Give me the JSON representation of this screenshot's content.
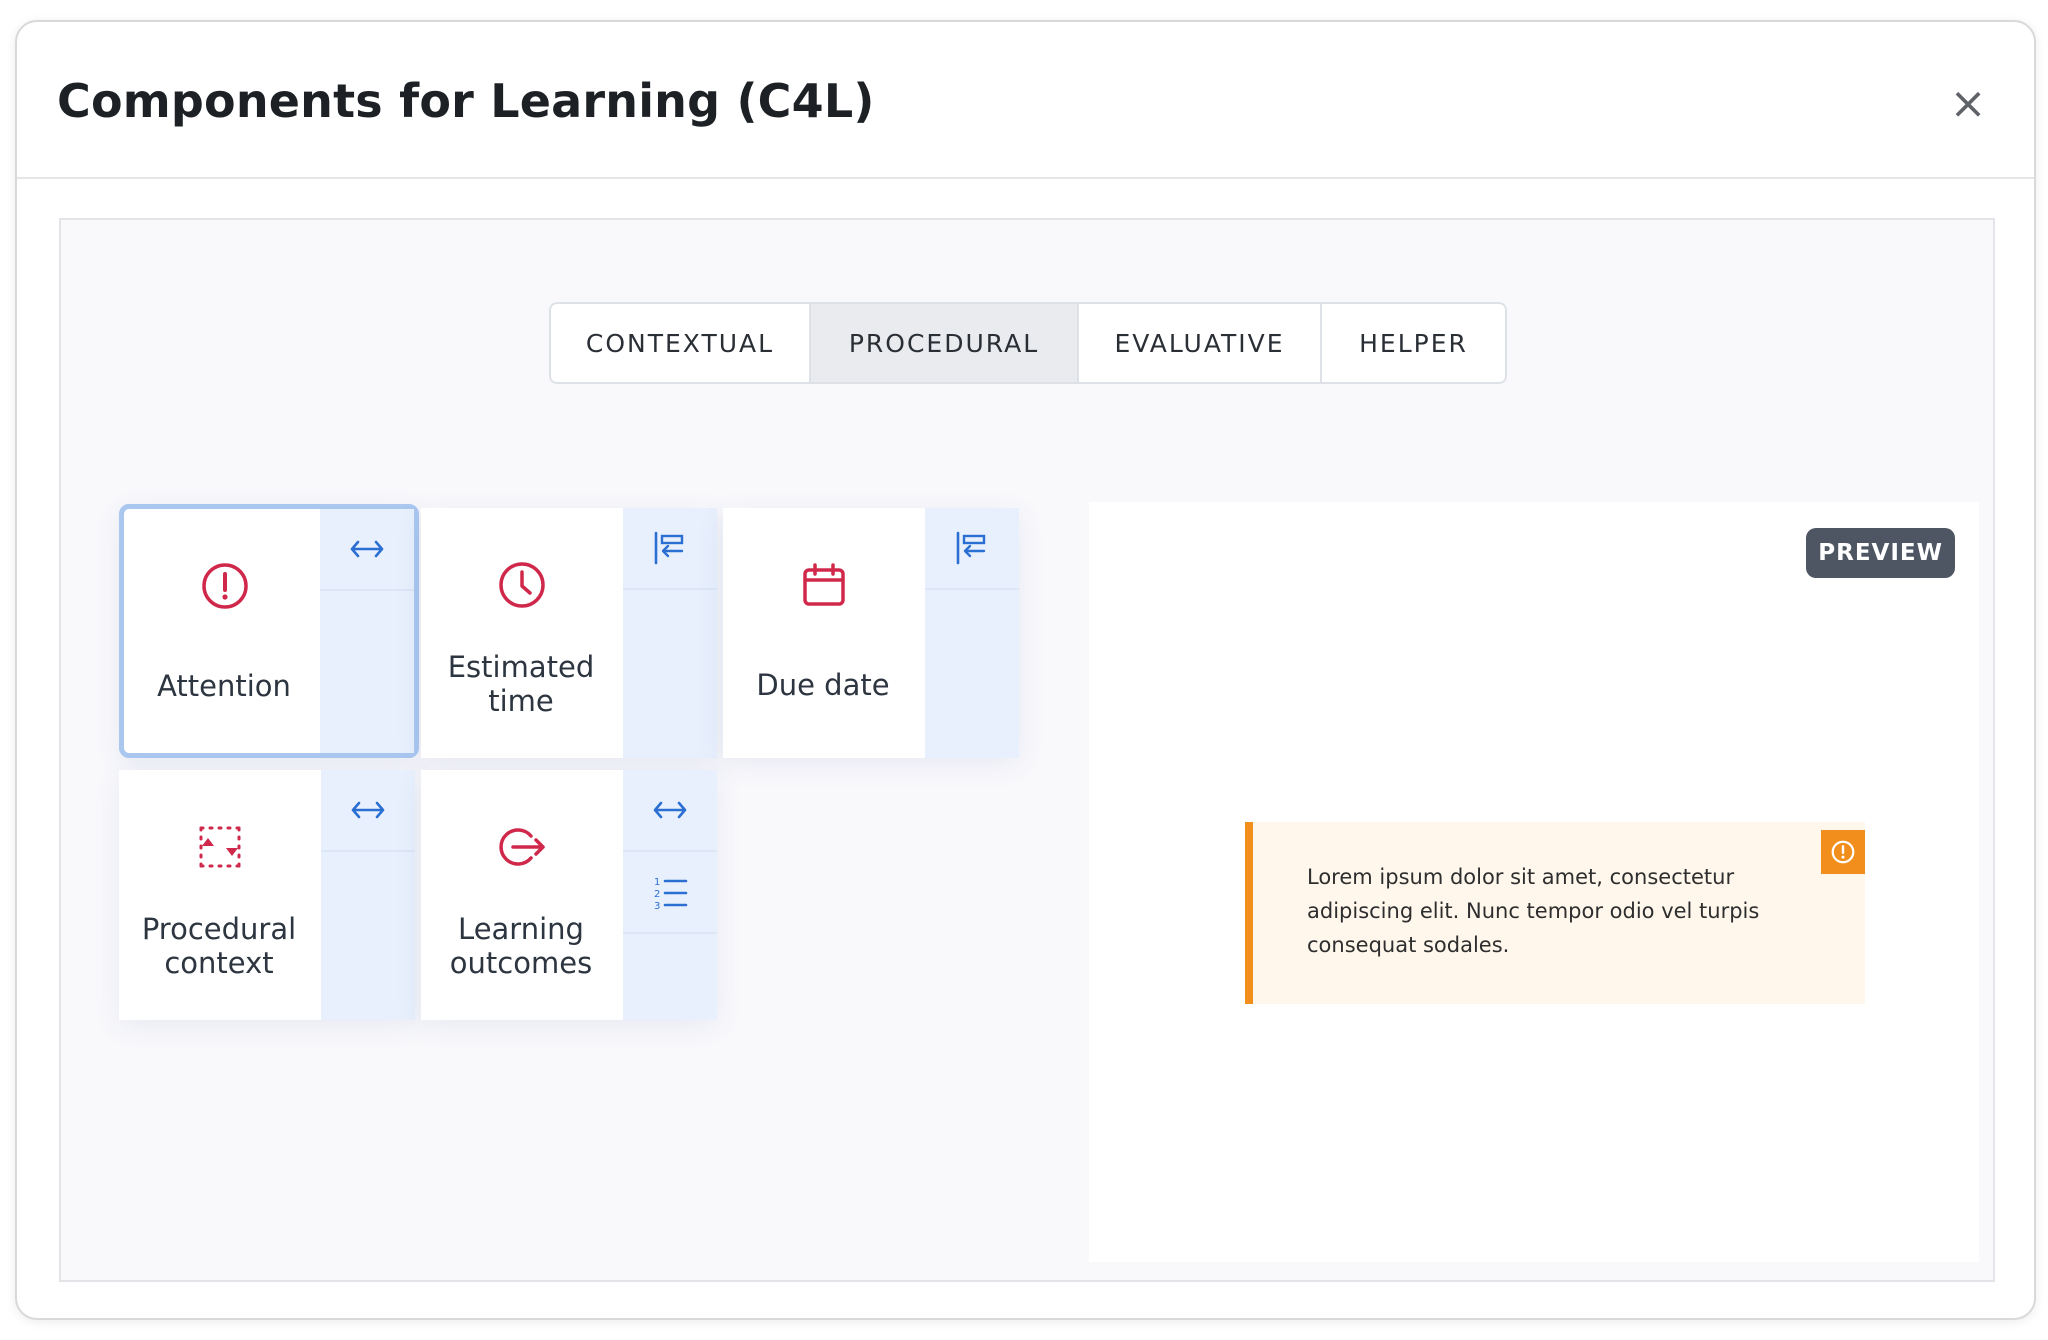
{
  "modal": {
    "title": "Components for Learning (C4L)",
    "close_symbol": "×"
  },
  "tabs": [
    {
      "label": "CONTEXTUAL",
      "active": false
    },
    {
      "label": "PROCEDURAL",
      "active": true
    },
    {
      "label": "EVALUATIVE",
      "active": false
    },
    {
      "label": "HELPER",
      "active": false
    }
  ],
  "components": [
    {
      "label": "Attention",
      "icon": "alert-circle-icon",
      "selected": true,
      "side_icons": [
        "arrows-horizontal-icon"
      ]
    },
    {
      "label": "Estimated time",
      "icon": "clock-icon",
      "selected": false,
      "side_icons": [
        "align-left-icon"
      ]
    },
    {
      "label": "Due date",
      "icon": "calendar-icon",
      "selected": false,
      "side_icons": [
        "align-left-icon"
      ]
    },
    {
      "label": "Procedural context",
      "icon": "procedural-context-icon",
      "selected": false,
      "side_icons": [
        "arrows-horizontal-icon"
      ]
    },
    {
      "label": "Learning outcomes",
      "icon": "sign-out-icon",
      "selected": false,
      "side_icons": [
        "arrows-horizontal-icon",
        "numbered-list-icon"
      ]
    }
  ],
  "preview": {
    "badge": "PREVIEW",
    "note_text": "Lorem ipsum dolor sit amet, consectetur adipiscing elit. Nunc tempor odio vel turpis consequat sodales."
  },
  "colors": {
    "icon_red": "#d0284a",
    "side_blue": "#2b6fd3",
    "accent_orange": "#f28e1c",
    "selected_border": "#a9c7ef"
  }
}
